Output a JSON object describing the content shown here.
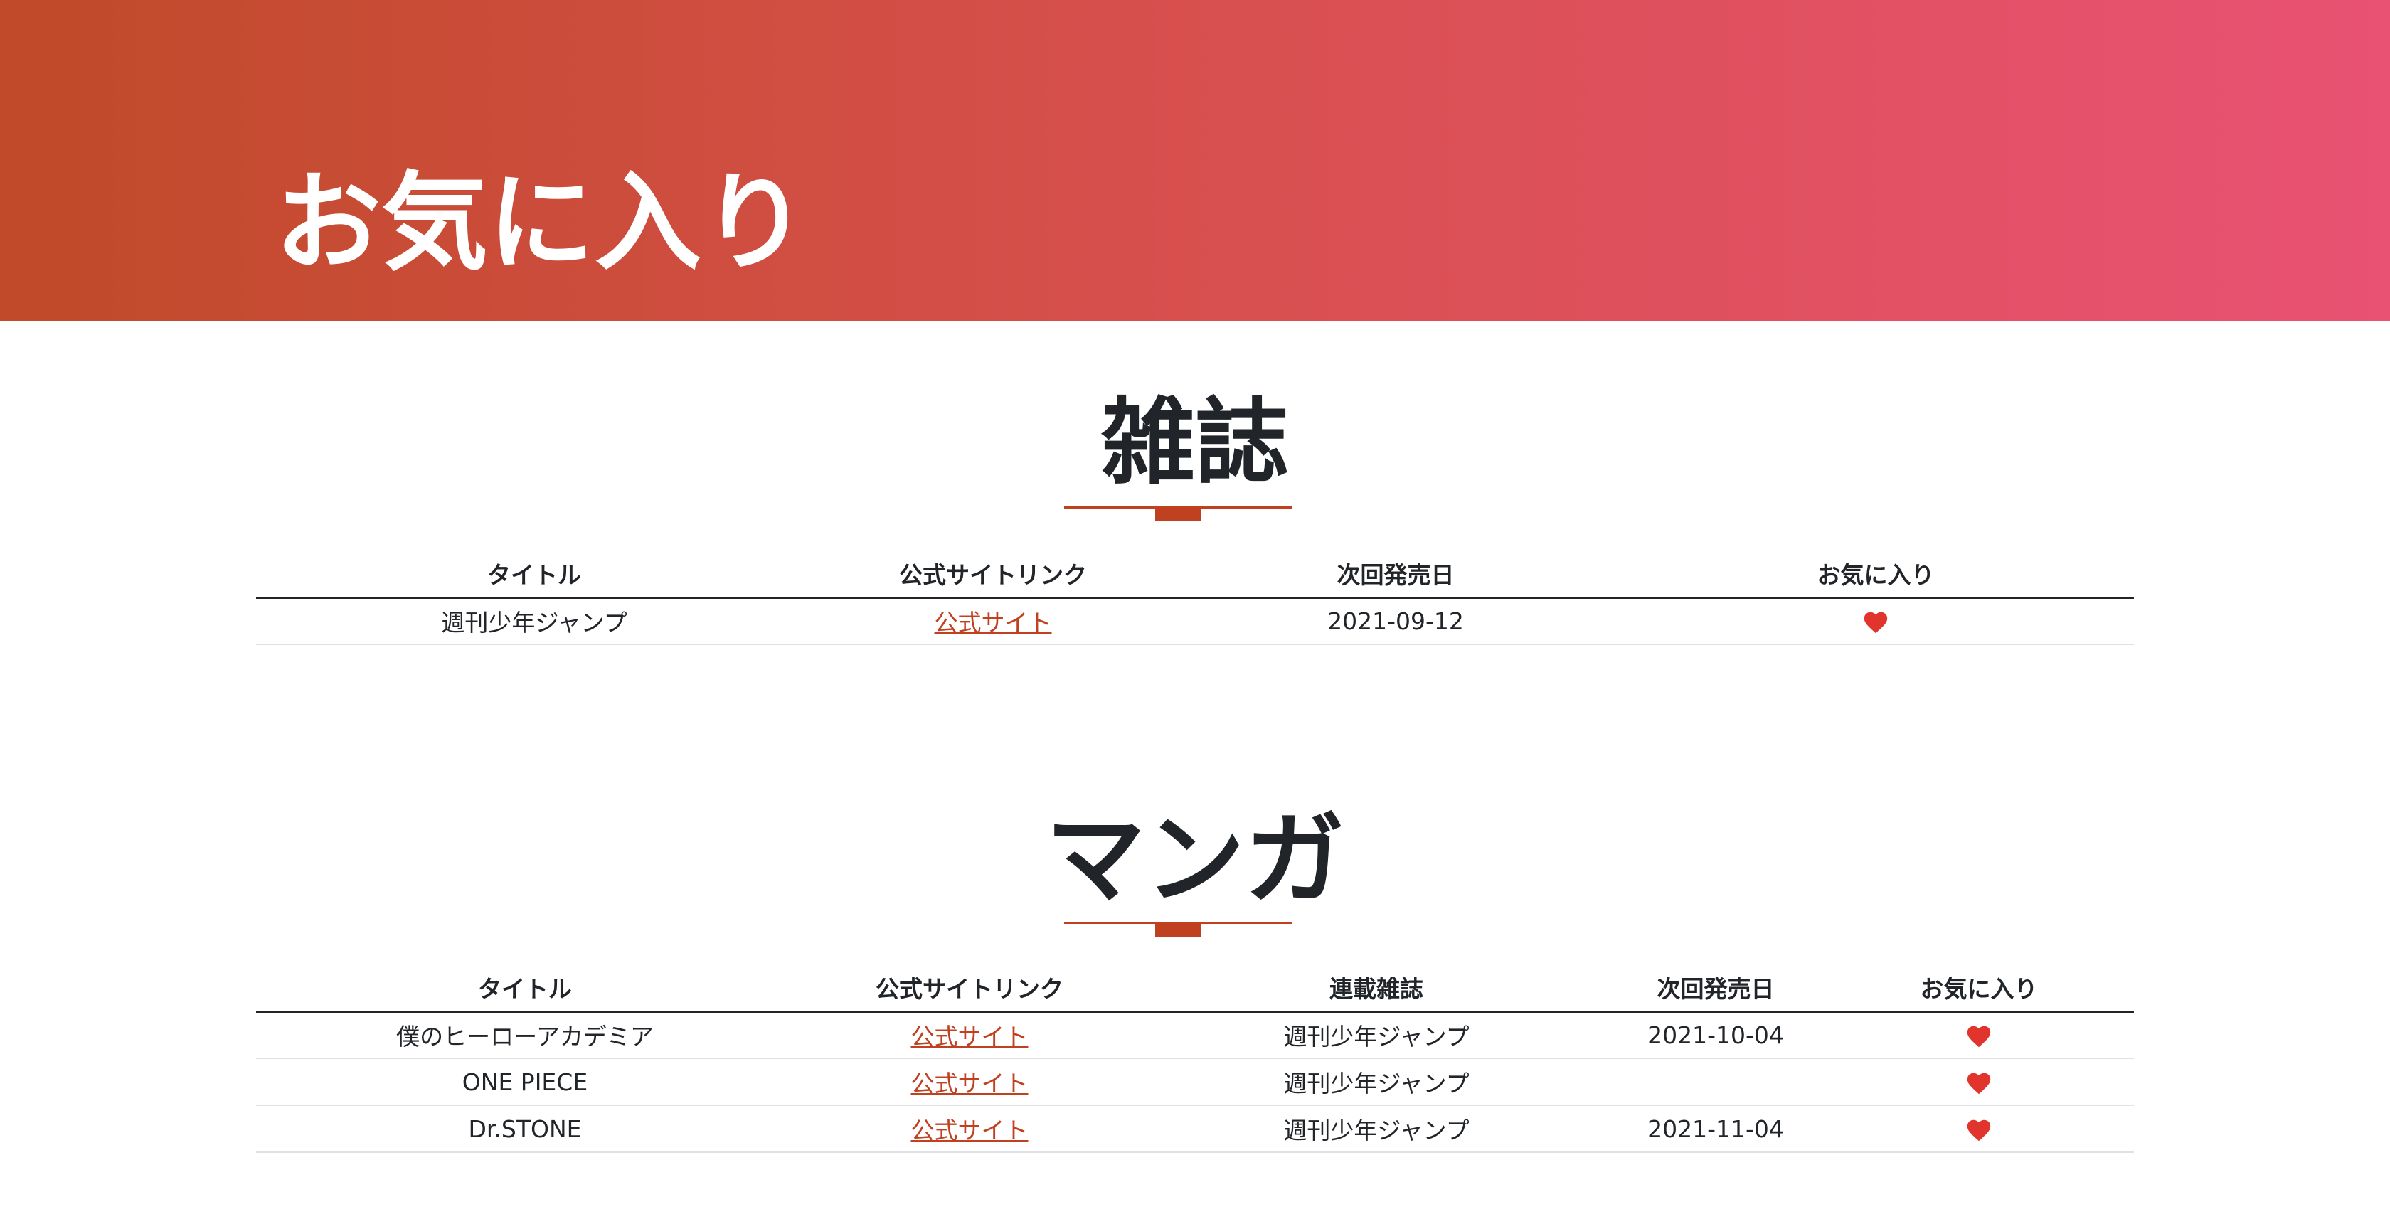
{
  "header": {
    "title": "お気に入り"
  },
  "magazine_section": {
    "heading": "雑誌",
    "columns": [
      "タイトル",
      "公式サイトリンク",
      "次回発売日",
      "お気に入り"
    ],
    "rows": [
      {
        "title": "週刊少年ジャンプ",
        "link_label": "公式サイト",
        "next_release": "2021-09-12",
        "favorite_icon": "heart-icon"
      }
    ]
  },
  "manga_section": {
    "heading": "マンガ",
    "columns": [
      "タイトル",
      "公式サイトリンク",
      "連載雑誌",
      "次回発売日",
      "お気に入り"
    ],
    "rows": [
      {
        "title": "僕のヒーローアカデミア",
        "link_label": "公式サイト",
        "magazine": "週刊少年ジャンプ",
        "next_release": "2021-10-04",
        "favorite_icon": "heart-icon"
      },
      {
        "title": "ONE PIECE",
        "link_label": "公式サイト",
        "magazine": "週刊少年ジャンプ",
        "next_release": "",
        "favorite_icon": "heart-icon"
      },
      {
        "title": "Dr.STONE",
        "link_label": "公式サイト",
        "magazine": "週刊少年ジャンプ",
        "next_release": "2021-11-04",
        "favorite_icon": "heart-icon"
      }
    ]
  },
  "colors": {
    "header_gradient_start": "#c04a29",
    "header_gradient_end": "#e95273",
    "accent": "#c0411f",
    "heart": "#e0342c",
    "text": "#212529"
  }
}
